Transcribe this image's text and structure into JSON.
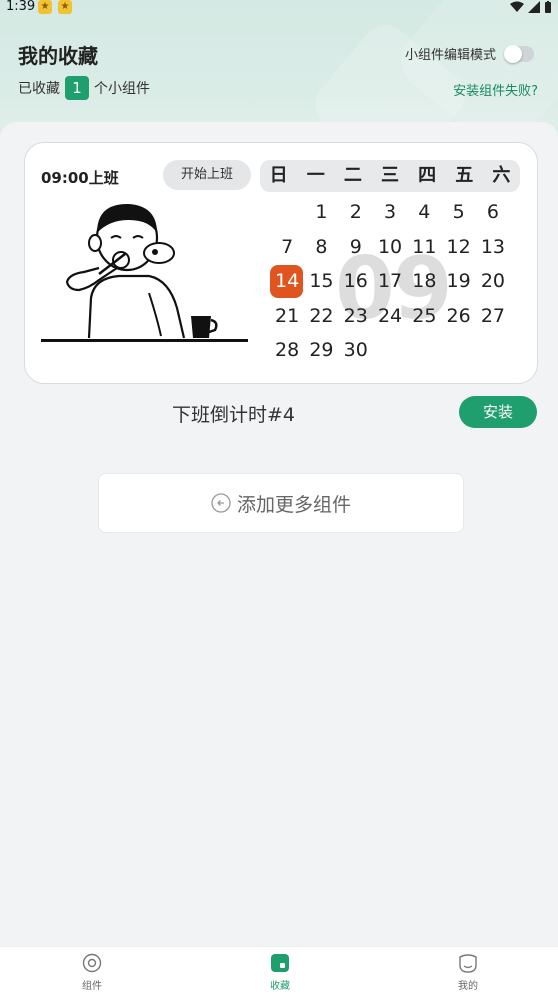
{
  "status_bar": {
    "time": "1:39"
  },
  "header": {
    "title": "我的收藏",
    "toggle_label": "小组件编辑模式",
    "collected_prefix": "已收藏",
    "collected_count": "1",
    "collected_suffix": "个小组件",
    "fail_link": "安装组件失败?"
  },
  "widget": {
    "time_label": "09:00上班",
    "start_button": "开始上班",
    "weekdays": [
      "日",
      "一",
      "二",
      "三",
      "四",
      "五",
      "六"
    ],
    "days": [
      "",
      "",
      "",
      "",
      "",
      "",
      "",
      "7",
      "8",
      "9",
      "10",
      "11",
      "12",
      "13",
      "14",
      "15",
      "16",
      "17",
      "18",
      "19",
      "20",
      "21",
      "22",
      "23",
      "24",
      "25",
      "26",
      "27",
      "28",
      "29",
      "30"
    ],
    "first_row": [
      "",
      "1",
      "2",
      "3",
      "4",
      "5",
      "6"
    ],
    "today": "14",
    "watermark": "09",
    "name": "下班倒计时#4",
    "install_button": "安装",
    "today_color": "#e0541f"
  },
  "add_more": {
    "label": "添加更多组件"
  },
  "tabbar": {
    "items": [
      {
        "label": "组件",
        "icon": "widget-icon"
      },
      {
        "label": "收藏",
        "icon": "favorite-icon"
      },
      {
        "label": "我的",
        "icon": "profile-icon"
      }
    ]
  },
  "colors": {
    "accent": "#1f9e6e"
  }
}
